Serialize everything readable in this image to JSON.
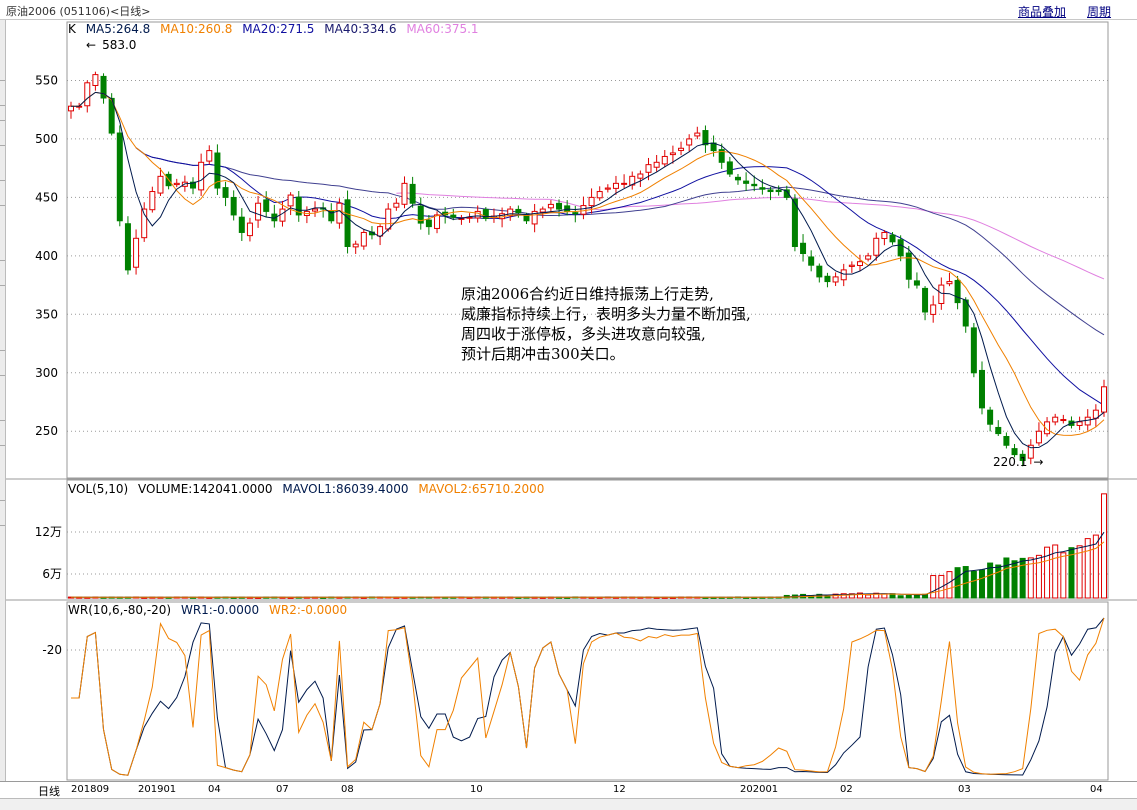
{
  "window": {
    "title": "原油2006 (051106)<日线>",
    "buttons": [
      "商品叠加",
      "周期"
    ]
  },
  "price_panel": {
    "legend": {
      "k_label": "K",
      "ma5": "MA5:264.8",
      "ma10": "MA10:260.8",
      "ma20": "MA20:271.5",
      "ma40": "MA40:334.6",
      "ma60": "MA60:375.1"
    },
    "high_mark": "583.0",
    "low_mark": "220.1",
    "y_ticks": [
      "550",
      "500",
      "450",
      "400",
      "350",
      "300",
      "250"
    ],
    "annotation": [
      "原油2006合约近日维持振荡上行走势,",
      "威廉指标持续上行，表明多头力量不断加强,",
      "周四收于涨停板，多头进攻意向较强,",
      "预计后期冲击300关口。"
    ]
  },
  "volume_panel": {
    "legend": {
      "vol": "VOL(5,10)",
      "volume": "VOLUME:142041.0000",
      "mavol1": "MAVOL1:86039.4000",
      "mavol2": "MAVOL2:65710.2000"
    },
    "y_ticks": [
      "12万",
      "6万"
    ]
  },
  "wr_panel": {
    "legend": {
      "wr": "WR(10,6,-80,-20)",
      "wr1": "WR1:-0.0000",
      "wr2": "WR2:-0.0000"
    },
    "y_ticks": [
      "-20"
    ]
  },
  "x_axis": {
    "period": "日线",
    "labels": [
      "201809",
      "201901",
      "04",
      "07",
      "08",
      "10",
      "12",
      "202001",
      "02",
      "03",
      "04"
    ]
  },
  "colors": {
    "up": "#e00000",
    "down": "#008000",
    "ma5": "#001a4d",
    "ma10": "#f08000",
    "ma20": "#1010a0",
    "ma40": "#404090",
    "ma60": "#e080e0",
    "mavol1": "#001a4d",
    "mavol2": "#f08000",
    "wr1": "#001a4d",
    "wr2": "#f08000",
    "link": "#000080"
  },
  "chart_data": {
    "type": "candlestick",
    "y_range": [
      210,
      600
    ],
    "x": [
      "201809",
      "201901",
      "04",
      "07",
      "08",
      "10",
      "12",
      "202001",
      "02",
      "03",
      "04"
    ],
    "candles_close": [
      528,
      528,
      548,
      555,
      535,
      505,
      430,
      388,
      415,
      440,
      455,
      468,
      460,
      462,
      463,
      458,
      480,
      490,
      458,
      450,
      435,
      420,
      428,
      445,
      438,
      430,
      440,
      452,
      435,
      438,
      440,
      440,
      430,
      445,
      408,
      410,
      420,
      418,
      425,
      440,
      445,
      462,
      445,
      428,
      425,
      435,
      435,
      433,
      432,
      433,
      438,
      432,
      434,
      436,
      440,
      437,
      430,
      438,
      440,
      444,
      440,
      438,
      436,
      443,
      450,
      455,
      458,
      462,
      462,
      468,
      470,
      478,
      480,
      485,
      488,
      492,
      500,
      505,
      495,
      490,
      480,
      470,
      465,
      462,
      460,
      457,
      455,
      455,
      450,
      408,
      402,
      392,
      382,
      378,
      382,
      388,
      392,
      395,
      400,
      415,
      420,
      412,
      400,
      380,
      375,
      352,
      358,
      375,
      378,
      360,
      340,
      300,
      270,
      256,
      248,
      238,
      230,
      225,
      238,
      250,
      258,
      262,
      260,
      255,
      258,
      262,
      268,
      288
    ],
    "ma_lines": [
      "MA5",
      "MA10",
      "MA20",
      "MA40",
      "MA60"
    ],
    "volume_range": [
      0,
      150000
    ],
    "wr_range": [
      -100,
      0
    ]
  }
}
